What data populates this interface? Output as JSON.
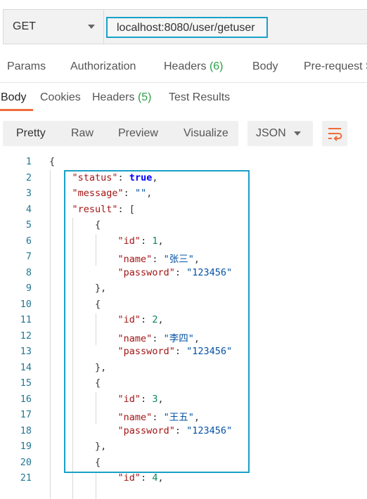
{
  "request": {
    "method": "GET",
    "url": "localhost:8080/user/getuser"
  },
  "request_tabs": [
    {
      "label": "Params",
      "count": ""
    },
    {
      "label": "Authorization",
      "count": ""
    },
    {
      "label": "Headers",
      "count": "(6)"
    },
    {
      "label": "Body",
      "count": ""
    },
    {
      "label": "Pre-request S",
      "count": ""
    }
  ],
  "response_tabs": [
    {
      "label": "Body",
      "count": ""
    },
    {
      "label": "Cookies",
      "count": ""
    },
    {
      "label": "Headers",
      "count": "(5)"
    },
    {
      "label": "Test Results",
      "count": ""
    }
  ],
  "view_modes": [
    "Pretty",
    "Raw",
    "Preview",
    "Visualize"
  ],
  "format": "JSON",
  "code_lines": [
    {
      "n": "1",
      "tokens": [
        {
          "t": "{",
          "c": "p"
        }
      ]
    },
    {
      "n": "2",
      "tokens": [
        {
          "t": "    ",
          "c": "p"
        },
        {
          "t": "\"status\"",
          "c": "k"
        },
        {
          "t": ": ",
          "c": "p"
        },
        {
          "t": "true",
          "c": "b"
        },
        {
          "t": ",",
          "c": "p"
        }
      ]
    },
    {
      "n": "3",
      "tokens": [
        {
          "t": "    ",
          "c": "p"
        },
        {
          "t": "\"message\"",
          "c": "k"
        },
        {
          "t": ": ",
          "c": "p"
        },
        {
          "t": "\"\"",
          "c": "s"
        },
        {
          "t": ",",
          "c": "p"
        }
      ]
    },
    {
      "n": "4",
      "tokens": [
        {
          "t": "    ",
          "c": "p"
        },
        {
          "t": "\"result\"",
          "c": "k"
        },
        {
          "t": ": [",
          "c": "p"
        }
      ]
    },
    {
      "n": "5",
      "tokens": [
        {
          "t": "        {",
          "c": "p"
        }
      ]
    },
    {
      "n": "6",
      "tokens": [
        {
          "t": "            ",
          "c": "p"
        },
        {
          "t": "\"id\"",
          "c": "k"
        },
        {
          "t": ": ",
          "c": "p"
        },
        {
          "t": "1",
          "c": "n"
        },
        {
          "t": ",",
          "c": "p"
        }
      ]
    },
    {
      "n": "7",
      "tokens": [
        {
          "t": "            ",
          "c": "p"
        },
        {
          "t": "\"name\"",
          "c": "k"
        },
        {
          "t": ": ",
          "c": "p"
        },
        {
          "t": "\"张三\"",
          "c": "s"
        },
        {
          "t": ",",
          "c": "p"
        }
      ]
    },
    {
      "n": "8",
      "tokens": [
        {
          "t": "            ",
          "c": "p"
        },
        {
          "t": "\"password\"",
          "c": "k"
        },
        {
          "t": ": ",
          "c": "p"
        },
        {
          "t": "\"123456\"",
          "c": "s"
        }
      ]
    },
    {
      "n": "9",
      "tokens": [
        {
          "t": "        },",
          "c": "p"
        }
      ]
    },
    {
      "n": "10",
      "tokens": [
        {
          "t": "        {",
          "c": "p"
        }
      ]
    },
    {
      "n": "11",
      "tokens": [
        {
          "t": "            ",
          "c": "p"
        },
        {
          "t": "\"id\"",
          "c": "k"
        },
        {
          "t": ": ",
          "c": "p"
        },
        {
          "t": "2",
          "c": "n"
        },
        {
          "t": ",",
          "c": "p"
        }
      ]
    },
    {
      "n": "12",
      "tokens": [
        {
          "t": "            ",
          "c": "p"
        },
        {
          "t": "\"name\"",
          "c": "k"
        },
        {
          "t": ": ",
          "c": "p"
        },
        {
          "t": "\"李四\"",
          "c": "s"
        },
        {
          "t": ",",
          "c": "p"
        }
      ]
    },
    {
      "n": "13",
      "tokens": [
        {
          "t": "            ",
          "c": "p"
        },
        {
          "t": "\"password\"",
          "c": "k"
        },
        {
          "t": ": ",
          "c": "p"
        },
        {
          "t": "\"123456\"",
          "c": "s"
        }
      ]
    },
    {
      "n": "14",
      "tokens": [
        {
          "t": "        },",
          "c": "p"
        }
      ]
    },
    {
      "n": "15",
      "tokens": [
        {
          "t": "        {",
          "c": "p"
        }
      ]
    },
    {
      "n": "16",
      "tokens": [
        {
          "t": "            ",
          "c": "p"
        },
        {
          "t": "\"id\"",
          "c": "k"
        },
        {
          "t": ": ",
          "c": "p"
        },
        {
          "t": "3",
          "c": "n"
        },
        {
          "t": ",",
          "c": "p"
        }
      ]
    },
    {
      "n": "17",
      "tokens": [
        {
          "t": "            ",
          "c": "p"
        },
        {
          "t": "\"name\"",
          "c": "k"
        },
        {
          "t": ": ",
          "c": "p"
        },
        {
          "t": "\"王五\"",
          "c": "s"
        },
        {
          "t": ",",
          "c": "p"
        }
      ]
    },
    {
      "n": "18",
      "tokens": [
        {
          "t": "            ",
          "c": "p"
        },
        {
          "t": "\"password\"",
          "c": "k"
        },
        {
          "t": ": ",
          "c": "p"
        },
        {
          "t": "\"123456\"",
          "c": "s"
        }
      ]
    },
    {
      "n": "19",
      "tokens": [
        {
          "t": "        },",
          "c": "p"
        }
      ]
    },
    {
      "n": "20",
      "tokens": [
        {
          "t": "        {",
          "c": "p"
        }
      ]
    },
    {
      "n": "21",
      "tokens": [
        {
          "t": "            ",
          "c": "p"
        },
        {
          "t": "\"id\"",
          "c": "k"
        },
        {
          "t": ": ",
          "c": "p"
        },
        {
          "t": "4",
          "c": "n"
        },
        {
          "t": ",",
          "c": "p"
        }
      ]
    }
  ],
  "colors": {
    "accent": "#f26b3a",
    "highlight": "#1aa0c8",
    "count_green": "#2e9e48",
    "json_key": "#a31515",
    "json_string": "#0451a5",
    "json_bool": "#0000ff",
    "json_number": "#098658",
    "line_number": "#237893"
  },
  "icons": [
    "chevron-down-icon",
    "wrap-lines-icon"
  ]
}
